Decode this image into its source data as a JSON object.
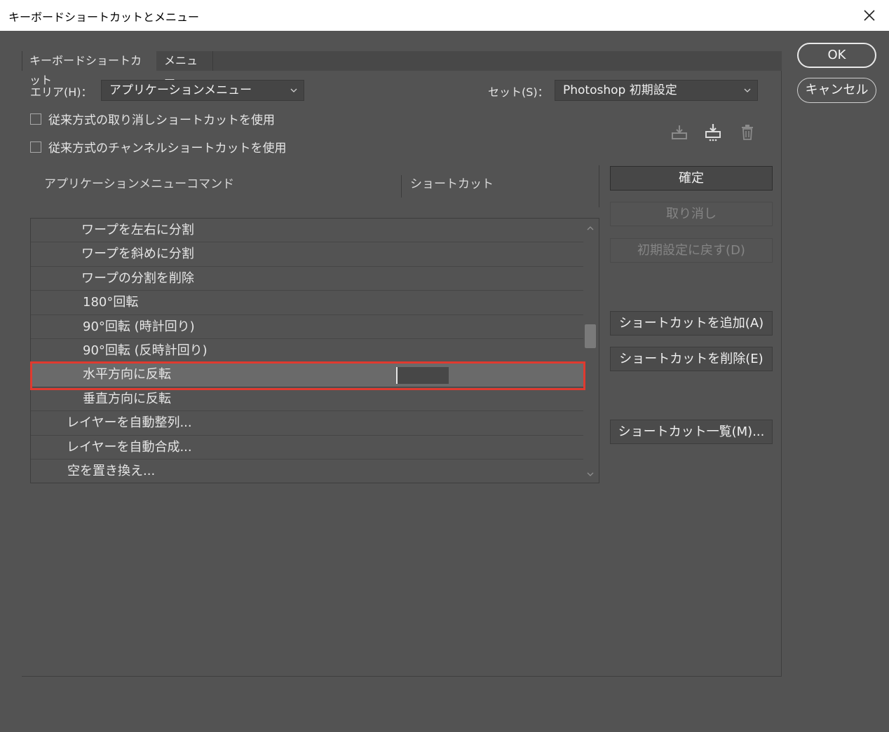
{
  "window": {
    "title": "キーボードショートカットとメニュー"
  },
  "tabs": [
    {
      "label": "キーボードショートカット"
    },
    {
      "label": "メニュー"
    }
  ],
  "area": {
    "label": "エリア(H)：",
    "selected": "アプリケーションメニュー"
  },
  "set": {
    "label": "セット(S)：",
    "selected": "Photoshop 初期設定"
  },
  "options": [
    {
      "label": "従来方式の取り消しショートカットを使用",
      "checked": false
    },
    {
      "label": "従来方式のチャンネルショートカットを使用",
      "checked": false
    }
  ],
  "columns": {
    "command": "アプリケーションメニューコマンド",
    "shortcut": "ショートカット"
  },
  "rows": [
    {
      "label": "ワープを左右に分割"
    },
    {
      "label": "ワープを斜めに分割"
    },
    {
      "label": "ワープの分割を削除"
    },
    {
      "label": "180°回転"
    },
    {
      "label": "90°回転 (時計回り)"
    },
    {
      "label": "90°回転 (反時計回り)"
    },
    {
      "label": "水平方向に反転",
      "selected": true,
      "shortcut": ""
    },
    {
      "label": "垂直方向に反転"
    },
    {
      "label": "レイヤーを自動整列..."
    },
    {
      "label": "レイヤーを自動合成..."
    },
    {
      "label": "空を置き換え..."
    }
  ],
  "side_buttons": {
    "accept": "確定",
    "undo": "取り消し",
    "use_default": "初期設定に戻す(D)",
    "add_shortcut": "ショートカットを追加(A)",
    "delete_shortcut": "ショートカットを削除(E)",
    "summarize": "ショートカット一覧(M)..."
  },
  "dialog_buttons": {
    "ok": "OK",
    "cancel": "キャンセル"
  },
  "colors": {
    "highlight": "#e03a2f",
    "background": "#535353"
  }
}
